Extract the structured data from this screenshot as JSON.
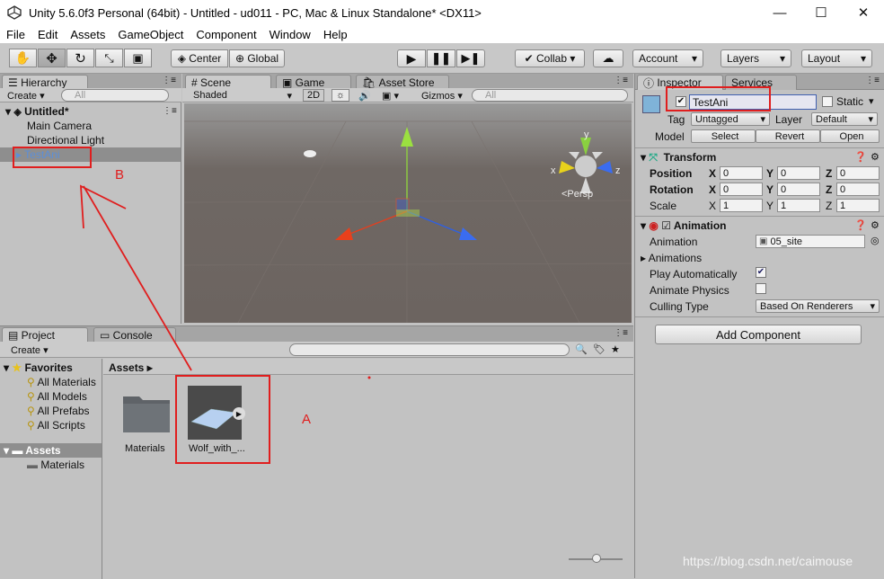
{
  "window": {
    "title": "Unity 5.6.0f3 Personal (64bit) - Untitled - ud011 - PC, Mac & Linux Standalone* <DX11>",
    "min": "—",
    "max": "☐",
    "close": "✕"
  },
  "menu": [
    "File",
    "Edit",
    "Assets",
    "GameObject",
    "Component",
    "Window",
    "Help"
  ],
  "toolbar": {
    "center": "Center",
    "global": "Global",
    "collab": "Collab ▾",
    "account": "Account",
    "layers": "Layers",
    "layout": "Layout"
  },
  "hierarchy": {
    "tab": "Hierarchy",
    "create": "Create ▾",
    "search_placeholder": "All",
    "scene": "Untitled*",
    "items": [
      "Main Camera",
      "Directional Light",
      "TestAni"
    ]
  },
  "scene": {
    "tabs": [
      "Scene",
      "Game",
      "Asset Store"
    ],
    "shaded": "Shaded",
    "mode2d": "2D",
    "gizmos": "Gizmos ▾",
    "search_placeholder": "All",
    "persp": "<Persp",
    "axis_y": "y",
    "axis_x": "x",
    "axis_z": "z"
  },
  "project": {
    "tabs": [
      "Project",
      "Console"
    ],
    "create": "Create ▾",
    "favorites": "Favorites",
    "fav_items": [
      "All Materials",
      "All Models",
      "All Prefabs",
      "All Scripts"
    ],
    "assets": "Assets",
    "asset_folders": [
      "Materials"
    ],
    "breadcrumb": "Assets",
    "grid": [
      "Materials",
      "Wolf_with_..."
    ]
  },
  "inspector": {
    "tabs": [
      "Inspector",
      "Services"
    ],
    "name": "TestAni",
    "static": "Static",
    "tag_label": "Tag",
    "tag": "Untagged",
    "layer_label": "Layer",
    "layer": "Default",
    "model_label": "Model",
    "model_btns": [
      "Select",
      "Revert",
      "Open"
    ],
    "transform": {
      "title": "Transform",
      "rows": [
        {
          "label": "Position",
          "x": "0",
          "y": "0",
          "z": "0"
        },
        {
          "label": "Rotation",
          "x": "0",
          "y": "0",
          "z": "0"
        },
        {
          "label": "Scale",
          "x": "1",
          "y": "1",
          "z": "1"
        }
      ]
    },
    "animation": {
      "title": "Animation",
      "fields": {
        "animation_label": "Animation",
        "animation_value": "05_site",
        "animations_label": "Animations",
        "play_label": "Play Automatically",
        "physics_label": "Animate Physics",
        "culling_label": "Culling Type",
        "culling_value": "Based On Renderers"
      }
    },
    "add_component": "Add Component"
  },
  "annotations": {
    "a": "A",
    "b": "B"
  },
  "watermark": "https://blog.csdn.net/caimouse",
  "colors": {
    "annotation": "#e01e1e",
    "scene_bg": "#6e6663",
    "selected": "#8a8a8a"
  }
}
